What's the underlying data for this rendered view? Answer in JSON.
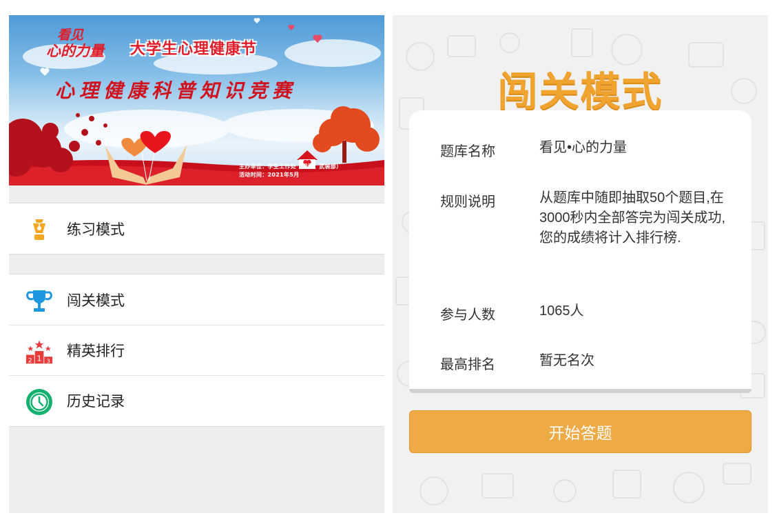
{
  "left_screen": {
    "banner": {
      "logo_line1": "看见",
      "logo_line2": "心的力量",
      "event_name": "大学生心理健康节",
      "title": "心理健康科普知识竞赛",
      "host": "主办单位：学生工作处（团委、武装部）",
      "time": "活动时间：2021年5月"
    },
    "menu": [
      {
        "label": "练习模式",
        "icon": "pen-nib-icon",
        "color": "#f5a623"
      },
      {
        "label": "闯关模式",
        "icon": "trophy-icon",
        "color": "#1e96e0"
      },
      {
        "label": "精英排行",
        "icon": "podium-icon",
        "color": "#e83b3b"
      },
      {
        "label": "历史记录",
        "icon": "clock-icon",
        "color": "#13b06e"
      }
    ]
  },
  "right_screen": {
    "title": "闯关模式",
    "info": {
      "bank_label": "题库名称",
      "bank_value": "看见•心的力量",
      "rules_label": "规则说明",
      "rules_value": "从题库中随即抽取50个题目,在3000秒内全部答完为闯关成功,您的成绩将计入排行榜.",
      "participants_label": "参与人数",
      "participants_value": "1065人",
      "best_rank_label": "最高排名",
      "best_rank_value": "暂无名次"
    },
    "start_button": "开始答题"
  },
  "colors": {
    "accent_orange": "#f0a32e",
    "button_orange": "#eeaa45",
    "banner_red": "#e11d2a"
  }
}
